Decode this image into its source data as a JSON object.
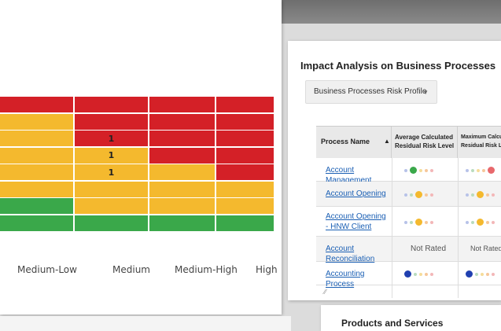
{
  "heatmap": {
    "colors": {
      "red": "#d42027",
      "yellow": "#f4b92e",
      "green": "#3aa84a"
    },
    "rows": [
      [
        "red",
        "red",
        "red",
        "red"
      ],
      [
        "yellow",
        "red",
        "red",
        "red"
      ],
      [
        "yellow",
        "red",
        "red",
        "red"
      ],
      [
        "yellow",
        "yellow",
        "red",
        "red"
      ],
      [
        "yellow",
        "yellow",
        "yellow",
        "red"
      ],
      [
        "yellow",
        "yellow",
        "yellow",
        "yellow"
      ],
      [
        "green",
        "yellow",
        "yellow",
        "yellow"
      ],
      [
        "green",
        "green",
        "green",
        "green"
      ]
    ],
    "counts": [
      {
        "row": 2,
        "col": 1,
        "value": "1"
      },
      {
        "row": 3,
        "col": 1,
        "value": "1"
      },
      {
        "row": 4,
        "col": 1,
        "value": "1"
      }
    ],
    "x_labels": [
      "Medium-Low",
      "Medium",
      "Medium-High",
      "High"
    ]
  },
  "impact": {
    "title": "Impact Analysis on Business Processes",
    "dropdown": {
      "value": "Business Processes Risk Profile",
      "icon": "chevron-down-icon"
    },
    "table": {
      "headers": {
        "process_name": "Process Name",
        "avg_line1": "Average Calculated",
        "avg_line2": "Residual Risk Level",
        "max_line1": "Maximum Calculated",
        "max_line2": "Residual Risk Level"
      },
      "rows": [
        {
          "name": "Account Management",
          "avg_active": 1,
          "max_active": 4,
          "avg_rated": true,
          "max_rated": true
        },
        {
          "name": "Account Opening",
          "avg_active": 2,
          "max_active": 2,
          "avg_rated": true,
          "max_rated": true
        },
        {
          "name": "Account Opening - HNW Client",
          "avg_active": 2,
          "max_active": 2,
          "avg_rated": true,
          "max_rated": true
        },
        {
          "name": "Account Reconciliation",
          "avg_text": "Not Rated",
          "max_text": "Not Rated",
          "avg_rated": false,
          "max_rated": false
        },
        {
          "name": "Accounting Process",
          "avg_active": 0,
          "max_active": 0,
          "avg_rated": true,
          "max_rated": true
        }
      ],
      "dot_colors": [
        "#2040b0",
        "#3aa84a",
        "#f4b92e",
        "#f08a24",
        "#e8686c"
      ],
      "dot_dim_colors": [
        "#b7c2e8",
        "#b9dcbe",
        "#f6dc99",
        "#f6c79a",
        "#f3b7b8"
      ]
    }
  },
  "products": {
    "title": "Products and Services"
  }
}
